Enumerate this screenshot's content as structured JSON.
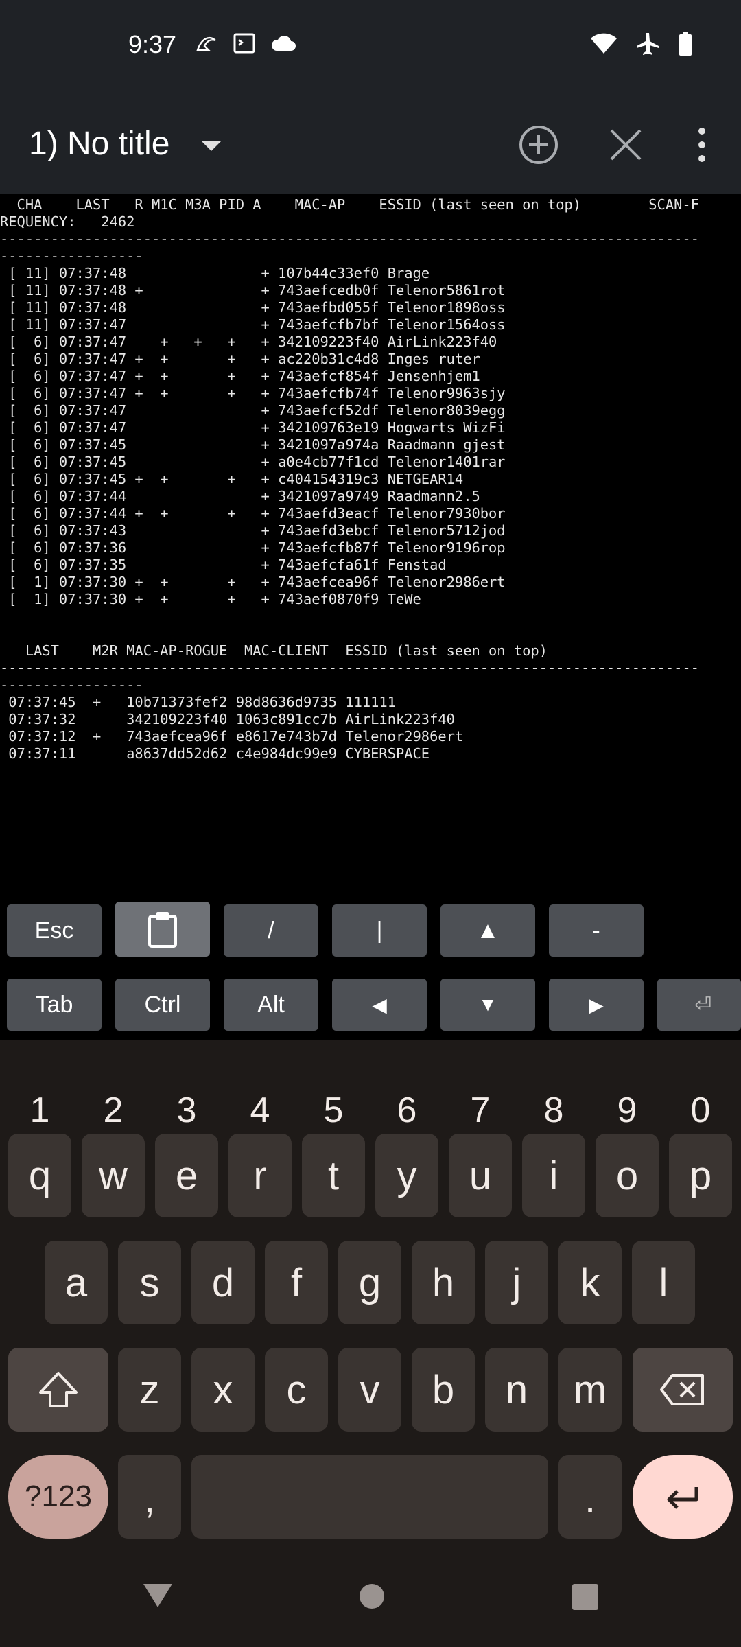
{
  "status_bar": {
    "time": "9:37",
    "left_icons": [
      "surf-icon",
      "terminal-icon",
      "cloud-icon"
    ],
    "right_icons": [
      "wifi-icon",
      "airplane-mode-icon",
      "battery-icon"
    ]
  },
  "toolbar": {
    "session_title": "1) No title"
  },
  "terminal": {
    "lines": [
      "  CHA    LAST   R M1C M3A PID A    MAC-AP    ESSID (last seen on top)        SCAN-F",
      "REQUENCY:   2462",
      "-----------------------------------------------------------------------------------",
      "-----------------",
      " [ 11] 07:37:48                + 107b44c33ef0 Brage",
      " [ 11] 07:37:48 +              + 743aefcedb0f Telenor5861rot",
      " [ 11] 07:37:48                + 743aefbd055f Telenor1898oss",
      " [ 11] 07:37:47                + 743aefcfb7bf Telenor1564oss",
      " [  6] 07:37:47    +   +   +   + 342109223f40 AirLink223f40",
      " [  6] 07:37:47 +  +       +   + ac220b31c4d8 Inges ruter",
      " [  6] 07:37:47 +  +       +   + 743aefcf854f Jensenhjem1",
      " [  6] 07:37:47 +  +       +   + 743aefcfb74f Telenor9963sjy",
      " [  6] 07:37:47                + 743aefcf52df Telenor8039egg",
      " [  6] 07:37:47                + 342109763e19 Hogwarts WizFi",
      " [  6] 07:37:45                + 3421097a974a Raadmann gjest",
      " [  6] 07:37:45                + a0e4cb77f1cd Telenor1401rar",
      " [  6] 07:37:45 +  +       +   + c404154319c3 NETGEAR14",
      " [  6] 07:37:44                + 3421097a9749 Raadmann2.5",
      " [  6] 07:37:44 +  +       +   + 743aefd3eacf Telenor7930bor",
      " [  6] 07:37:43                + 743aefd3ebcf Telenor5712jod",
      " [  6] 07:37:36                + 743aefcfb87f Telenor9196rop",
      " [  6] 07:37:35                + 743aefcfa61f Fenstad",
      " [  1] 07:37:30 +  +       +   + 743aefcea96f Telenor2986ert",
      " [  1] 07:37:30 +  +       +   + 743aef0870f9 TeWe",
      "",
      "",
      "   LAST    M2R MAC-AP-ROGUE  MAC-CLIENT  ESSID (last seen on top)",
      "-----------------------------------------------------------------------------------",
      "-----------------",
      " 07:37:45  +   10b71373fef2 98d8636d9735 111111",
      " 07:37:32      342109223f40 1063c891cc7b AirLink223f40",
      " 07:37:12  +   743aefcea96f e8617e743b7d Telenor2986ert",
      " 07:37:11      a8637dd52d62 c4e984dc99e9 CYBERSPACE"
    ]
  },
  "extra_keys": {
    "row1": [
      "Esc",
      "clipboard",
      "/",
      "|",
      "▲",
      "-"
    ],
    "row2": [
      "Tab",
      "Ctrl",
      "Alt",
      "◀",
      "▼",
      "▶",
      "⏎"
    ]
  },
  "keyboard": {
    "numbers": [
      "1",
      "2",
      "3",
      "4",
      "5",
      "6",
      "7",
      "8",
      "9",
      "0"
    ],
    "row1": [
      "q",
      "w",
      "e",
      "r",
      "t",
      "y",
      "u",
      "i",
      "o",
      "p"
    ],
    "row2": [
      "a",
      "s",
      "d",
      "f",
      "g",
      "h",
      "j",
      "k",
      "l"
    ],
    "row3": [
      "z",
      "x",
      "c",
      "v",
      "b",
      "n",
      "m"
    ],
    "symbols_label": "?123",
    "comma": ",",
    "period": "."
  }
}
